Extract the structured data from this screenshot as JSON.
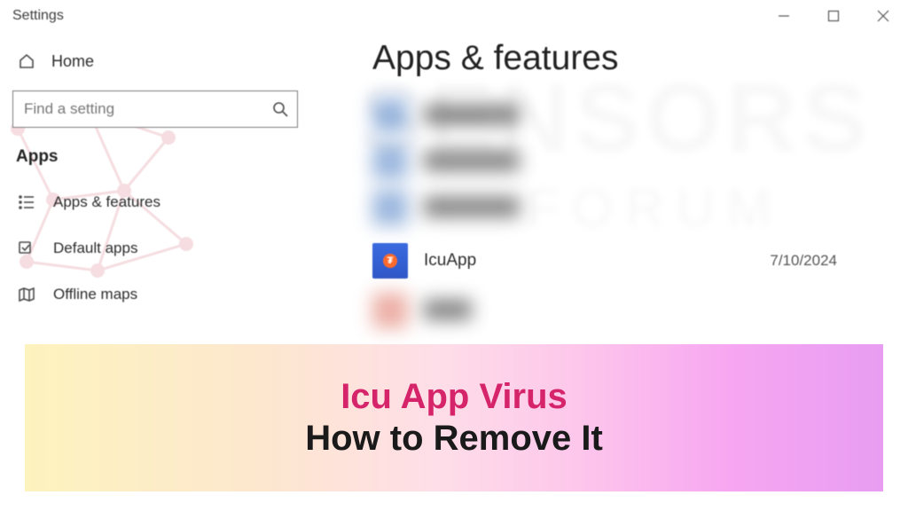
{
  "window": {
    "title": "Settings",
    "home_label": "Home",
    "search_placeholder": "Find a setting",
    "category_header": "Apps",
    "nav": [
      {
        "label": "Apps & features"
      },
      {
        "label": "Default apps"
      },
      {
        "label": "Offline maps"
      }
    ]
  },
  "content": {
    "page_title": "Apps & features",
    "apps": {
      "icu": {
        "name": "IcuApp",
        "date": "7/10/2024"
      }
    }
  },
  "banner": {
    "line1": "Icu App Virus",
    "line2": "How to Remove It"
  }
}
